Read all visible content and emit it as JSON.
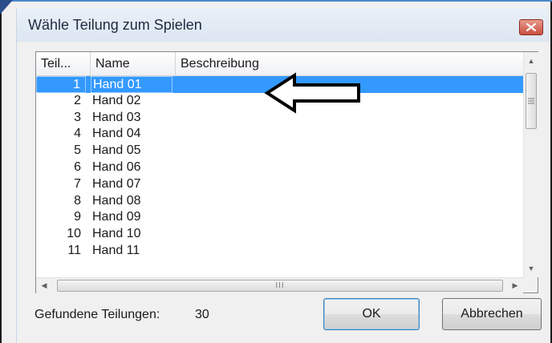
{
  "dialog": {
    "title": "Wähle Teilung zum Spielen",
    "close_icon": "close-icon"
  },
  "list": {
    "columns": [
      "Teil...",
      "Name",
      "Beschreibung"
    ],
    "rows": [
      {
        "num": "1",
        "name": "Hand 01",
        "selected": true
      },
      {
        "num": "2",
        "name": "Hand 02"
      },
      {
        "num": "3",
        "name": "Hand 03"
      },
      {
        "num": "4",
        "name": "Hand 04"
      },
      {
        "num": "5",
        "name": "Hand 05"
      },
      {
        "num": "6",
        "name": "Hand 06"
      },
      {
        "num": "7",
        "name": "Hand 07"
      },
      {
        "num": "8",
        "name": "Hand 08"
      },
      {
        "num": "9",
        "name": "Hand 09"
      },
      {
        "num": "10",
        "name": "Hand 10"
      },
      {
        "num": "11",
        "name": "Hand 11"
      }
    ],
    "hscroll_grip": "III"
  },
  "footer": {
    "found_label": "Gefundene Teilungen:",
    "found_count": "30",
    "ok_label": "OK",
    "cancel_label": "Abbrechen"
  },
  "colors": {
    "selection": "#3399ff",
    "close_button": "#c9503f"
  }
}
